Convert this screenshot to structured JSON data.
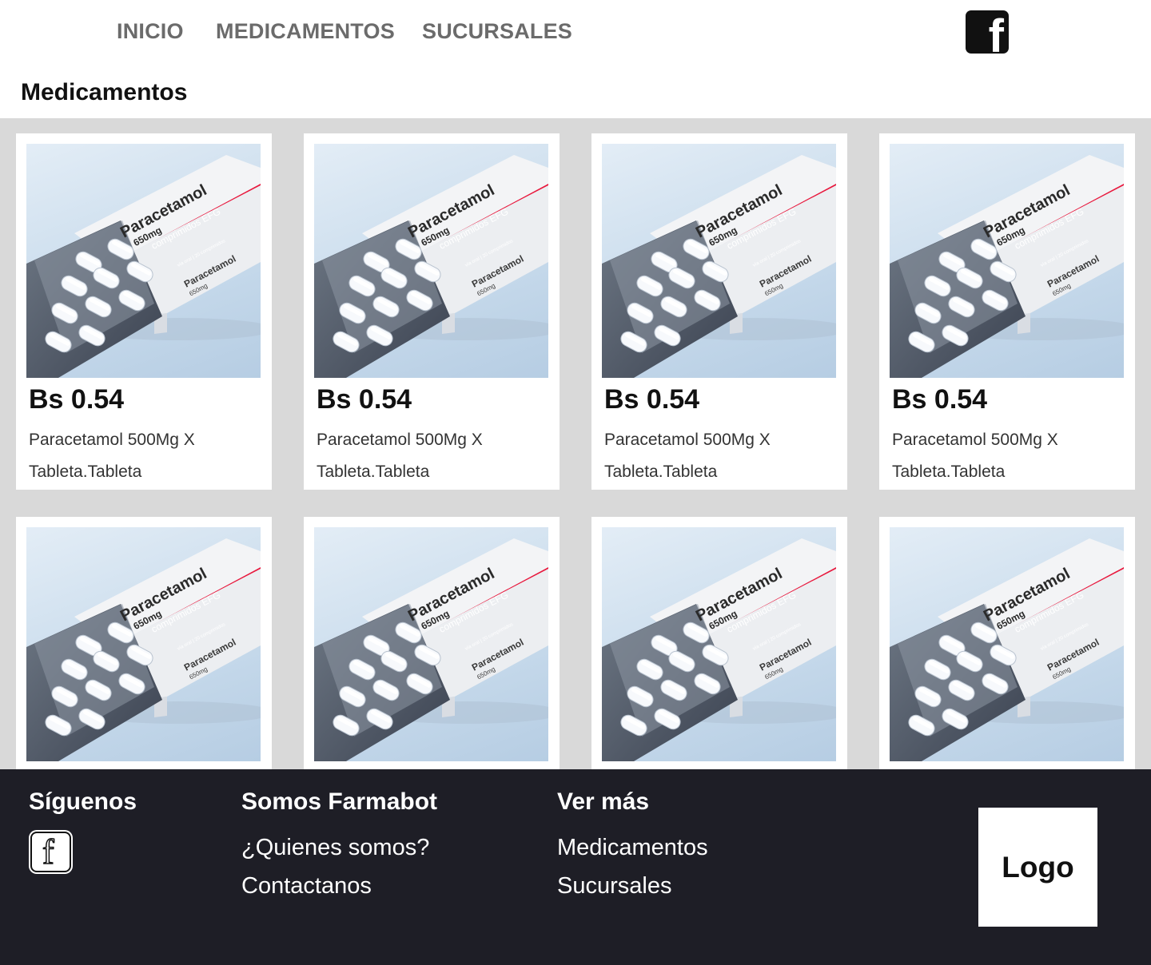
{
  "nav": {
    "items": [
      "INICIO",
      "MEDICAMENTOS",
      "SUCURSALES"
    ],
    "social_icon": "facebook-icon"
  },
  "page_title": "Medicamentos",
  "products": [
    {
      "price": "Bs 0.54",
      "name": "Paracetamol 500Mg X Tableta.Tableta",
      "image": "paracetamol-box"
    },
    {
      "price": "Bs 0.54",
      "name": "Paracetamol 500Mg X Tableta.Tableta",
      "image": "paracetamol-box"
    },
    {
      "price": "Bs 0.54",
      "name": "Paracetamol 500Mg X Tableta.Tableta",
      "image": "paracetamol-box"
    },
    {
      "price": "Bs 0.54",
      "name": "Paracetamol 500Mg X Tableta.Tableta",
      "image": "paracetamol-box"
    },
    {
      "price": "",
      "name": "",
      "image": "paracetamol-box"
    },
    {
      "price": "",
      "name": "",
      "image": "paracetamol-box"
    },
    {
      "price": "",
      "name": "",
      "image": "paracetamol-box"
    },
    {
      "price": "",
      "name": "",
      "image": "paracetamol-box"
    }
  ],
  "product_image_text": {
    "brand": "Paracetamol",
    "dose": "650mg",
    "tagline": "comprimidos EFG",
    "side": "vía oral | 20 comprimidos",
    "side_brand": "Paracetamol",
    "side_dose": "650mg"
  },
  "footer": {
    "follow_heading": "Síguenos",
    "about_heading": "Somos Farmabot",
    "about_links": [
      "¿Quienes somos?",
      "Contactanos"
    ],
    "more_heading": "Ver más",
    "more_links": [
      "Medicamentos",
      "Sucursales"
    ],
    "logo_text": "Logo"
  },
  "colors": {
    "accent_red": "#e8173c",
    "footer_bg": "#1e1e26",
    "grid_bg": "#d9d9d9",
    "nav_text": "#6b6b6b"
  }
}
